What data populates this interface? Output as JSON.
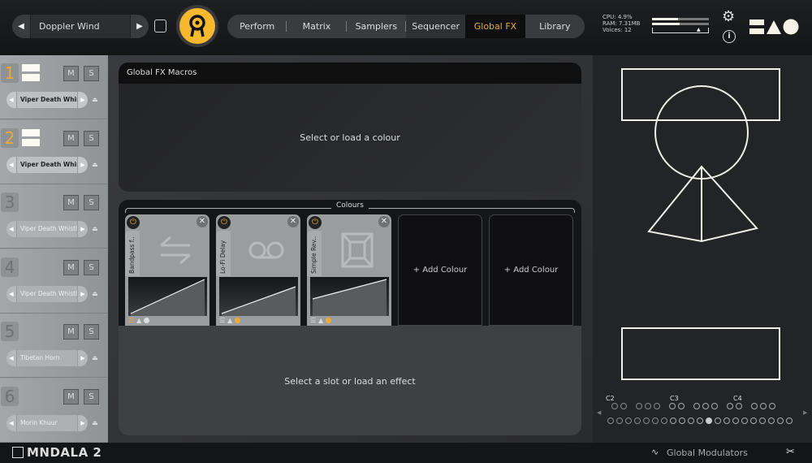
{
  "header": {
    "preset_name": "Doppler Wind",
    "prev": "◀",
    "next": "▶",
    "tabs": [
      {
        "label": "Perform"
      },
      {
        "label": "Matrix"
      },
      {
        "label": "Samplers"
      },
      {
        "label": "Sequencer"
      },
      {
        "label": "Global FX",
        "active": true
      },
      {
        "label": "Library"
      }
    ],
    "cpu": "CPU: 4.9%",
    "ram": "RAM: 7.31MB",
    "voices": "Voices: 12",
    "meter_levels": [
      0.45,
      0.48
    ],
    "accent": "#f0a830"
  },
  "sidebar": {
    "slots": [
      {
        "number": "1",
        "sound": "Viper Death Whistle",
        "active": true,
        "mute": "M",
        "solo": "S"
      },
      {
        "number": "2",
        "sound": "Viper Death Whistle",
        "active": true,
        "mute": "M",
        "solo": "S"
      },
      {
        "number": "3",
        "sound": "Viper Death Whistle",
        "active": false,
        "mute": "M",
        "solo": "S"
      },
      {
        "number": "4",
        "sound": "Viper Death Whistle",
        "active": false,
        "mute": "M",
        "solo": "S"
      },
      {
        "number": "5",
        "sound": "Tibetan Horn",
        "active": false,
        "mute": "M",
        "solo": "S"
      },
      {
        "number": "6",
        "sound": "Morin Khuur",
        "active": false,
        "mute": "M",
        "solo": "S"
      }
    ]
  },
  "macros": {
    "title": "Global FX Macros",
    "message": "Select or load a colour"
  },
  "colours": {
    "label": "Colours",
    "cards": [
      {
        "name": "Bandpass f..",
        "icon": "swap-arrows-icon"
      },
      {
        "name": "Lo-Fi Delay",
        "icon": "tape-reel-icon"
      },
      {
        "name": "Simple Rev..",
        "icon": "room-icon"
      }
    ],
    "add_label": "+ Add Colour",
    "effect_message": "Select a slot or load an effect"
  },
  "keyboard": {
    "labels": [
      "C2",
      "C3",
      "C4"
    ],
    "active_white_key": 11
  },
  "footer": {
    "brand": "MNDALA 2",
    "modulators": "Global Modulators"
  }
}
